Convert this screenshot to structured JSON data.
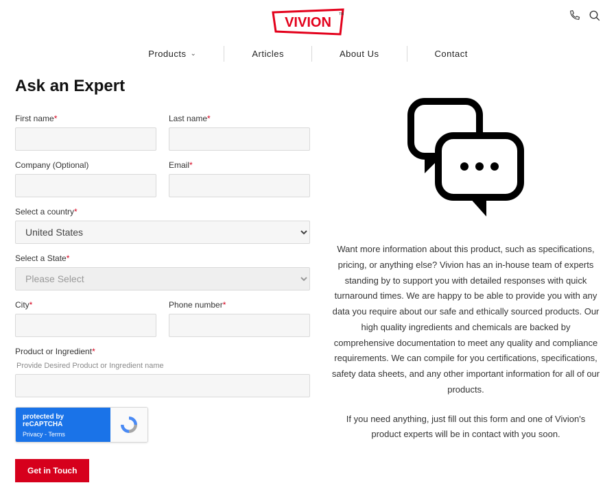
{
  "brand": "VIVION",
  "nav": {
    "products": "Products",
    "articles": "Articles",
    "about": "About Us",
    "contact": "Contact"
  },
  "title": "Ask an Expert",
  "form": {
    "first_name_label": "First name",
    "last_name_label": "Last name",
    "company_label": "Company (Optional)",
    "email_label": "Email",
    "country_label": "Select a country",
    "country_value": "United States",
    "state_label": "Select a State",
    "state_placeholder": "Please Select",
    "city_label": "City",
    "phone_label": "Phone number",
    "product_label": "Product or Ingredient",
    "product_hint": "Provide Desired Product or Ingredient name",
    "recaptcha_top": "protected by reCAPTCHA",
    "recaptcha_bottom": "Privacy - Terms",
    "submit_label": "Get in Touch"
  },
  "info": {
    "p1": "Want more information about this product, such as specifications, pricing, or anything else? Vivion has an in-house team of experts standing by to support you with detailed responses with quick turnaround times. We are happy to be able to provide you with any data you require about our safe and ethically sourced products. Our high quality ingredients and chemicals are backed by comprehensive documentation to meet any quality and compliance requirements. We can compile for you certifications, specifications, safety data sheets, and any other important information for all of our products.",
    "p2": "If you need anything, just fill out this form and one of Vivion's product experts will be in contact with you soon."
  }
}
